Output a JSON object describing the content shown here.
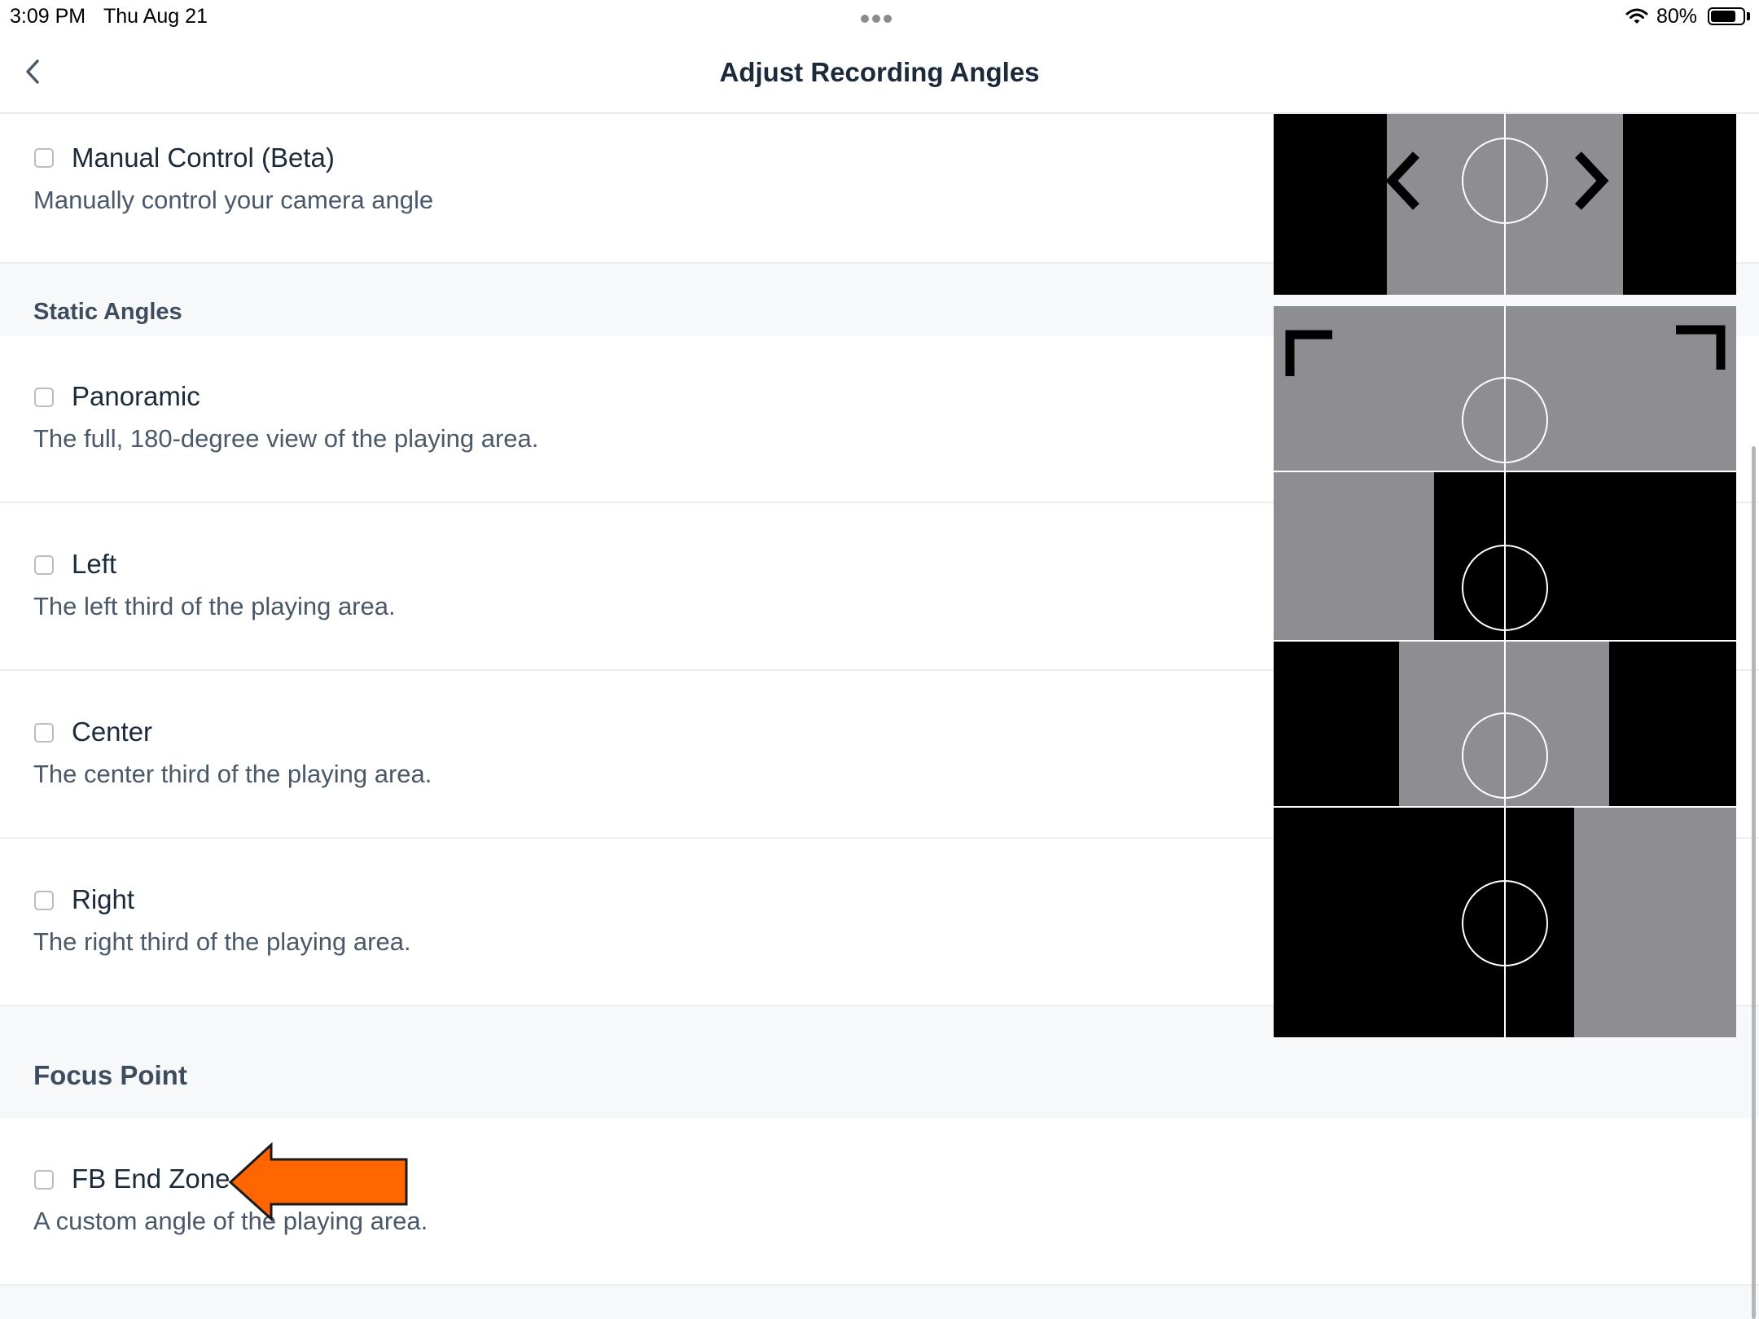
{
  "status_bar": {
    "time": "3:09 PM",
    "date": "Thu Aug 21",
    "battery_percent": "80%",
    "battery_level": 0.8
  },
  "nav": {
    "title": "Adjust Recording Angles"
  },
  "manual": {
    "title": "Manual Control (Beta)",
    "description": "Manually control your camera angle"
  },
  "static_angles": {
    "header": "Static Angles",
    "items": [
      {
        "title": "Panoramic",
        "description": "The full, 180-degree view of the playing area."
      },
      {
        "title": "Left",
        "description": "The left third of the playing area."
      },
      {
        "title": "Center",
        "description": "The center third of the playing area."
      },
      {
        "title": "Right",
        "description": "The right third of the playing area."
      }
    ]
  },
  "focus_point": {
    "header": "Focus Point",
    "items": [
      {
        "title": "FB End Zone",
        "description": "A custom angle of the playing area."
      }
    ]
  },
  "colors": {
    "field_gray": "#8e8e92",
    "dark": "#000000",
    "annotation_arrow": "#ff6600"
  },
  "icons": {
    "back": "chevron-left-icon",
    "pan_left": "chevron-left-icon",
    "pan_right": "chevron-right-icon"
  }
}
